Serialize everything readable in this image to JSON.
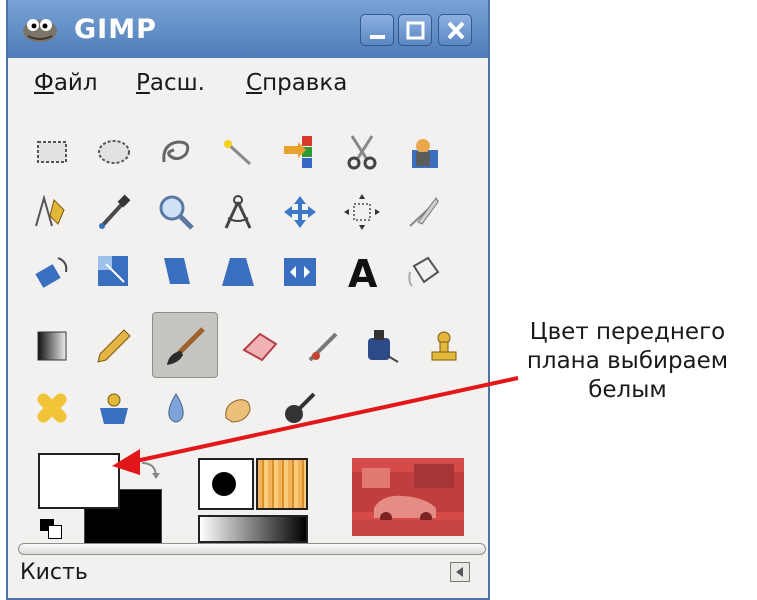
{
  "window": {
    "title": "GIMP",
    "colors": {
      "titlebar": "#5f8bc6",
      "window_bg": "#f2f1ef",
      "accent_arrow": "#e3171a"
    }
  },
  "menu": [
    {
      "mnemonic": "Ф",
      "rest": "айл"
    },
    {
      "mnemonic": "Р",
      "rest": "асш."
    },
    {
      "mnemonic": "С",
      "rest": "правка"
    }
  ],
  "tools": [
    [
      "rect-select-icon",
      "ellipse-select-icon",
      "free-select-icon",
      "fuzzy-select-icon",
      "color-select-icon",
      "scissors-icon",
      "foreground-select-icon"
    ],
    [
      "paths-icon",
      "color-picker-icon",
      "zoom-icon",
      "measure-icon",
      "move-icon",
      "align-icon",
      "crop-icon"
    ],
    [
      "rotate-icon",
      "scale-icon",
      "shear-icon",
      "perspective-icon",
      "flip-icon",
      "text-icon",
      "bucket-fill-icon"
    ],
    [
      "blend-icon",
      "pencil-icon",
      "paintbrush-icon",
      "eraser-icon",
      "airbrush-icon",
      "ink-icon",
      "clone-icon"
    ],
    [
      "heal-icon",
      "perspective-clone-icon",
      "blur-icon",
      "smudge-icon",
      "dodge-burn-icon"
    ]
  ],
  "active_tool": "paintbrush-icon",
  "colors": {
    "foreground": "#ffffff",
    "background": "#000000"
  },
  "dock": {
    "label": "Кисть"
  },
  "annotation": {
    "lines": [
      "Цвет переднего",
      "плана выбираем",
      "белым"
    ]
  }
}
